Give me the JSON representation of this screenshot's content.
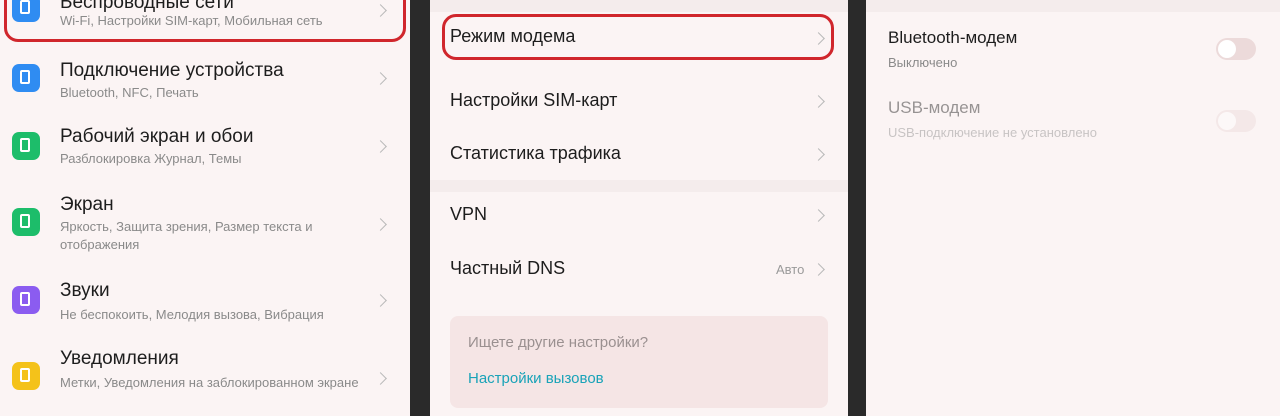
{
  "settings": {
    "items": [
      {
        "title": "Беспроводные сети",
        "sub": "Wi-Fi, Настройки SIM-карт, Мобильная сеть",
        "icon": "wifi-icon",
        "color": "#2f8cf2"
      },
      {
        "title": "Подключение устройства",
        "sub": "Bluetooth, NFC, Печать",
        "icon": "device-connection-icon",
        "color": "#2f8cf2"
      },
      {
        "title": "Рабочий экран и обои",
        "sub": "Разблокировка Журнал, Темы",
        "icon": "home-screen-icon",
        "color": "#1dbd6a"
      },
      {
        "title": "Экран",
        "sub": "Яркость, Защита зрения, Размер текста и отображения",
        "icon": "display-icon",
        "color": "#1dbd6a"
      },
      {
        "title": "Звуки",
        "sub": "Не беспокоить, Мелодия вызова, Вибрация",
        "icon": "sound-icon",
        "color": "#8b5cf0"
      },
      {
        "title": "Уведомления",
        "sub": "Метки, Уведомления на заблокированном экране",
        "icon": "notification-icon",
        "color": "#f4c21a"
      }
    ]
  },
  "more": {
    "items": [
      {
        "title": "Режим модема"
      },
      {
        "title": "Настройки SIM-карт"
      },
      {
        "title": "Статистика трафика"
      },
      {
        "title": "VPN"
      },
      {
        "title": "Частный DNS",
        "value": "Авто"
      }
    ],
    "card": {
      "question": "Ищете другие настройки?",
      "link": "Настройки вызовов"
    }
  },
  "modem": {
    "items": [
      {
        "title": "Bluetooth-модем",
        "sub": "Выключено",
        "enabled": true
      },
      {
        "title": "USB-модем",
        "sub": "USB-подключение не установлено",
        "enabled": false
      }
    ]
  },
  "colors": {
    "highlight": "#d0262c",
    "link": "#1aa3b8"
  }
}
